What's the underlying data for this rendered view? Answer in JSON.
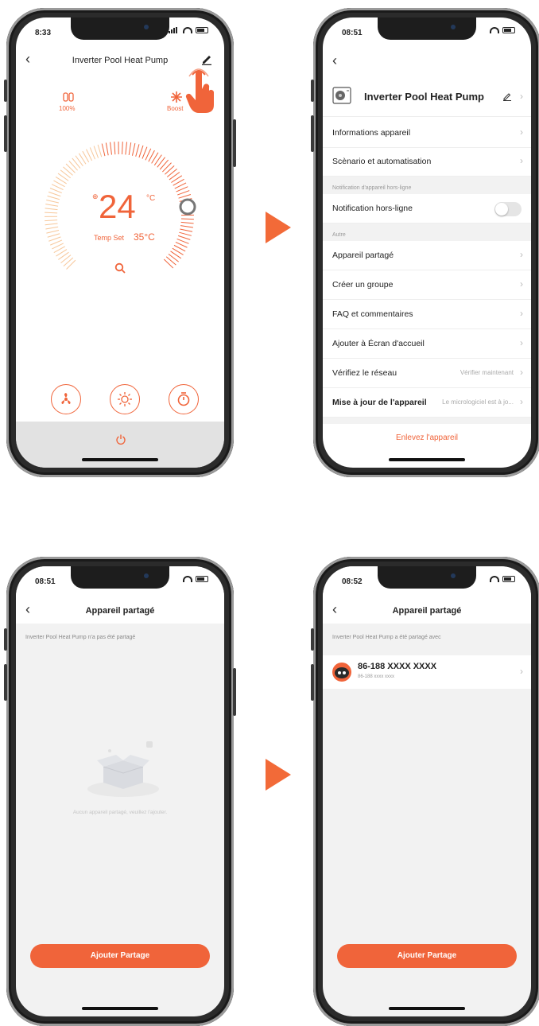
{
  "colors": {
    "accent": "#f0643a",
    "arrow": "#f26a38"
  },
  "phone1": {
    "time": "8:33",
    "title": "Inverter Pool Heat Pump",
    "mode_left_value": "100%",
    "mode_right_label": "Boost",
    "temperature": "24",
    "temp_unit": "°C",
    "temp_set_label": "Temp Set",
    "temp_set_value": "35°C",
    "icons": [
      "fan-icon",
      "sun-icon",
      "timer-icon",
      "power-icon",
      "search-icon",
      "edit-icon"
    ]
  },
  "phone2": {
    "time": "08:51",
    "device_name": "Inverter Pool Heat Pump",
    "rows": {
      "info": "Informations appareil",
      "scenario": "Scènario et automatisation",
      "section_offline": "Notification d'appareil hors-ligne",
      "offline": "Notification hors-ligne",
      "section_other": "Autre",
      "shared": "Appareil partagé",
      "group": "Créer un groupe",
      "faq": "FAQ et commentaires",
      "home": "Ajouter à Écran d'accueil",
      "network": "Vérifiez le réseau",
      "network_value": "Vérifier maintenant",
      "firmware": "Mise à jour de l'appareil",
      "firmware_value": "Le micrologiciel est à jo...",
      "remove": "Enlevez l'appareil"
    }
  },
  "phone3": {
    "time": "08:51",
    "title": "Appareil partagé",
    "subtitle": "Inverter Pool Heat Pump n'a pas été partagé",
    "empty_text": "Aucun appareil partagé, veuillez l'ajouter.",
    "button": "Ajouter Partage"
  },
  "phone4": {
    "time": "08:52",
    "title": "Appareil partagé",
    "subtitle": "Inverter Pool Heat Pump a été partagé avec",
    "user_name": "86-188 XXXX XXXX",
    "user_sub": "86-188 xxxx xxxx",
    "button": "Ajouter Partage"
  }
}
